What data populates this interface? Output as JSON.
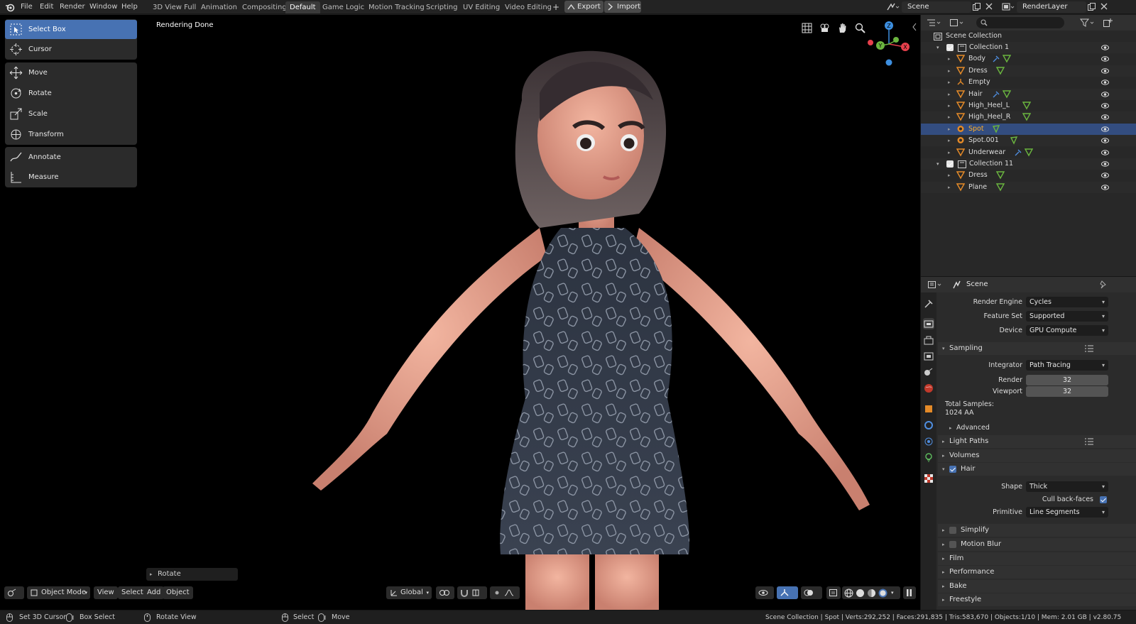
{
  "menubar": {
    "items": [
      "File",
      "Edit",
      "Render",
      "Window",
      "Help"
    ],
    "workspaces": [
      "3D View Full",
      "Animation",
      "Compositing",
      "Default",
      "Game Logic",
      "Motion Tracking",
      "Scripting",
      "UV Editing",
      "Video Editing"
    ],
    "active_workspace": "Default",
    "add_tab": "+",
    "export_label": "Export",
    "import_label": "Import",
    "scene_name": "Scene",
    "view_layer": "RenderLayer"
  },
  "viewport": {
    "status": "Rendering Done",
    "tools": {
      "select": [
        "Select Box",
        "Cursor"
      ],
      "transform": [
        "Move",
        "Rotate",
        "Scale",
        "Transform"
      ],
      "annotate": [
        "Annotate",
        "Measure"
      ]
    },
    "active_tool": "Select Box",
    "last_operator": "Rotate",
    "gizmo_axes": [
      "Z",
      "Y",
      "X"
    ],
    "header": {
      "mode": "Object Mode",
      "menus": [
        "View",
        "Select",
        "Add",
        "Object"
      ],
      "orientation": "Global"
    }
  },
  "outliner": {
    "root": "Scene Collection",
    "rows": [
      {
        "label": "Collection 1",
        "kind": "collection",
        "indent": 1
      },
      {
        "label": "Body",
        "kind": "mesh",
        "indent": 2
      },
      {
        "label": "Dress",
        "kind": "mesh",
        "indent": 2
      },
      {
        "label": "Empty",
        "kind": "empty",
        "indent": 2
      },
      {
        "label": "Hair",
        "kind": "mesh",
        "indent": 2
      },
      {
        "label": "High_Heel_L",
        "kind": "mesh",
        "indent": 2
      },
      {
        "label": "High_Heel_R",
        "kind": "mesh",
        "indent": 2
      },
      {
        "label": "Spot",
        "kind": "light",
        "indent": 2,
        "selected": true
      },
      {
        "label": "Spot.001",
        "kind": "light",
        "indent": 2
      },
      {
        "label": "Underwear",
        "kind": "mesh",
        "indent": 2
      },
      {
        "label": "Collection 11",
        "kind": "collection",
        "indent": 1
      },
      {
        "label": "Dress",
        "kind": "mesh",
        "indent": 2
      },
      {
        "label": "Plane",
        "kind": "mesh",
        "indent": 2
      }
    ]
  },
  "properties": {
    "context": "Scene",
    "render_engine": {
      "label": "Render Engine",
      "value": "Cycles"
    },
    "feature_set": {
      "label": "Feature Set",
      "value": "Supported"
    },
    "device": {
      "label": "Device",
      "value": "GPU Compute"
    },
    "sampling": {
      "title": "Sampling",
      "integrator": {
        "label": "Integrator",
        "value": "Path Tracing"
      },
      "render": {
        "label": "Render",
        "value": "32"
      },
      "viewport": {
        "label": "Viewport",
        "value": "32"
      },
      "total_label": "Total Samples:",
      "total_value": "1024 AA",
      "advanced": "Advanced"
    },
    "sections": [
      "Light Paths",
      "Volumes"
    ],
    "hair": {
      "title": "Hair",
      "enabled": true,
      "shape": {
        "label": "Shape",
        "value": "Thick"
      },
      "cull": {
        "label": "Cull back-faces",
        "checked": true
      },
      "primitive": {
        "label": "Primitive",
        "value": "Line Segments"
      }
    },
    "closed_sections": [
      "Simplify",
      "Motion Blur",
      "Film",
      "Performance",
      "Bake",
      "Freestyle"
    ]
  },
  "statusbar": {
    "left": [
      "Set 3D Cursor",
      "Box Select",
      "Rotate View"
    ],
    "middle": [
      "Select",
      "Move"
    ],
    "stats": "Scene Collection | Spot | Verts:292,252 | Faces:291,835 | Tris:583,670 | Objects:1/10 | Mem: 2.01 GB | v2.80.75"
  },
  "colors": {
    "accent": "#4772b3",
    "selected_row": "#334d80",
    "active_object": "#ffaf29",
    "axis_x": "#e7404c",
    "axis_y": "#6bb63f",
    "axis_z": "#3d8fe0"
  }
}
